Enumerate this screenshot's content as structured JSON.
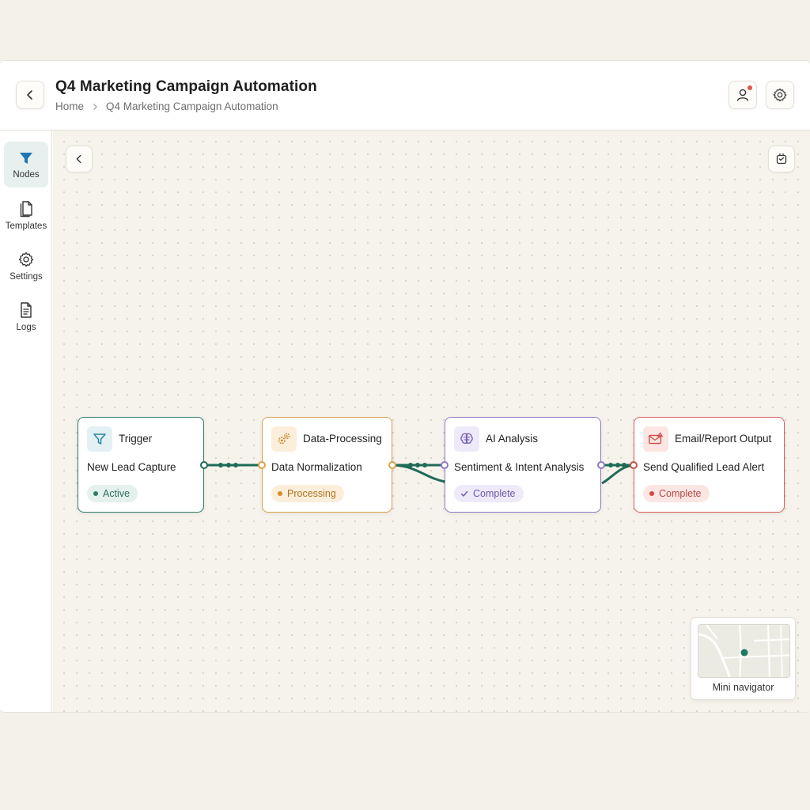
{
  "header": {
    "title": "Q4 Marketing Campaign Automation",
    "breadcrumb": [
      "Home",
      "Q4 Marketing Campaign Automation"
    ]
  },
  "sidebar": {
    "items": [
      {
        "label": "Nodes",
        "icon": "funnel-icon",
        "active": true
      },
      {
        "label": "Templates",
        "icon": "document-icon",
        "active": false
      },
      {
        "label": "Settings",
        "icon": "gear-icon",
        "active": false
      },
      {
        "label": "Logs",
        "icon": "log-file-icon",
        "active": false
      }
    ]
  },
  "nodes": [
    {
      "type": "Trigger",
      "name": "New Lead Capture",
      "status": "Active",
      "icon": "funnel-icon",
      "accent": "#2f7d6b",
      "status_bg": "#e4f1ed",
      "status_color": "#2f6f5f"
    },
    {
      "type": "Data-Processing",
      "name": "Data Normalization",
      "status": "Processing",
      "icon": "gears-icon",
      "accent": "#d9a24a",
      "status_bg": "#fbeedb",
      "status_color": "#b0741f"
    },
    {
      "type": "AI Analysis",
      "name": "Sentiment & Intent Analysis",
      "status": "Complete",
      "icon": "brain-icon",
      "accent": "#8e78c9",
      "status_bg": "#efeaf9",
      "status_color": "#6c58a8"
    },
    {
      "type": "Email/Report Output",
      "name": "Send Qualified Lead Alert",
      "status": "Complete",
      "icon": "email-alert-icon",
      "accent": "#d9605a",
      "status_bg": "#fbe6e4",
      "status_color": "#b84a44"
    }
  ],
  "connector_color": "#1f6b57",
  "minimap": {
    "label": "Mini navigator"
  }
}
